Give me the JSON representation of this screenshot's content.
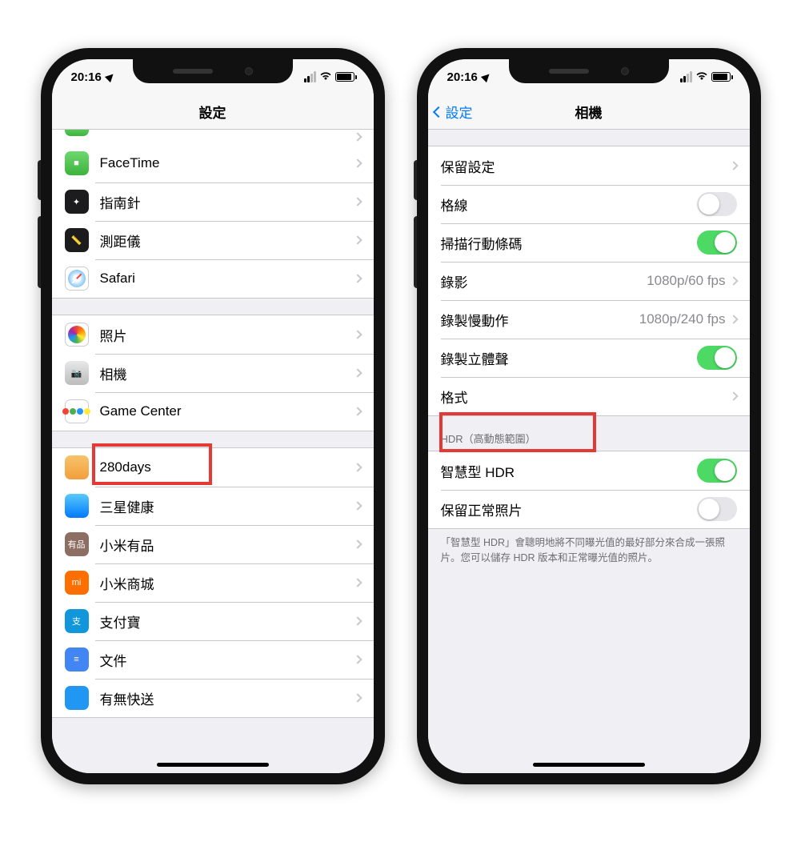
{
  "status": {
    "time": "20:16"
  },
  "left": {
    "title": "設定",
    "group1_partial": "",
    "group1": [
      {
        "label": "FaceTime",
        "icon": "ic-facetime",
        "glyph": "■"
      },
      {
        "label": "指南針",
        "icon": "ic-compass",
        "glyph": "✦"
      },
      {
        "label": "測距儀",
        "icon": "ic-measure",
        "glyph": "📏"
      },
      {
        "label": "Safari",
        "icon": "ic-safari",
        "glyph": ""
      }
    ],
    "group2": [
      {
        "label": "照片",
        "icon": "ic-photos",
        "glyph": ""
      },
      {
        "label": "相機",
        "icon": "ic-camera",
        "glyph": "📷",
        "highlight": true
      },
      {
        "label": "Game Center",
        "icon": "ic-gc",
        "glyph": ""
      }
    ],
    "group3": [
      {
        "label": "280days",
        "icon": "ic-280",
        "glyph": ""
      },
      {
        "label": "三星健康",
        "icon": "ic-sam",
        "glyph": ""
      },
      {
        "label": "小米有品",
        "icon": "ic-mi1",
        "glyph": "有品"
      },
      {
        "label": "小米商城",
        "icon": "ic-mi2",
        "glyph": "mi"
      },
      {
        "label": "支付寶",
        "icon": "ic-ali",
        "glyph": "支"
      },
      {
        "label": "文件",
        "icon": "ic-docs",
        "glyph": "≡"
      },
      {
        "label": "有無快送",
        "icon": "ic-yowo",
        "glyph": ""
      }
    ]
  },
  "right": {
    "back": "設定",
    "title": "相機",
    "group1": [
      {
        "label": "保留設定",
        "type": "nav"
      },
      {
        "label": "格線",
        "type": "toggle",
        "on": false
      },
      {
        "label": "掃描行動條碼",
        "type": "toggle",
        "on": true
      },
      {
        "label": "錄影",
        "type": "nav",
        "detail": "1080p/60 fps"
      },
      {
        "label": "錄製慢動作",
        "type": "nav",
        "detail": "1080p/240 fps"
      },
      {
        "label": "錄製立體聲",
        "type": "toggle",
        "on": true
      },
      {
        "label": "格式",
        "type": "nav",
        "highlight": true
      }
    ],
    "hdr_header": "HDR（高動態範圍）",
    "group2": [
      {
        "label": "智慧型 HDR",
        "type": "toggle",
        "on": true
      },
      {
        "label": "保留正常照片",
        "type": "toggle",
        "on": false
      }
    ],
    "hdr_footer": "「智慧型 HDR」會聰明地將不同曝光值的最好部分來合成一張照片。您可以儲存 HDR 版本和正常曝光值的照片。"
  }
}
